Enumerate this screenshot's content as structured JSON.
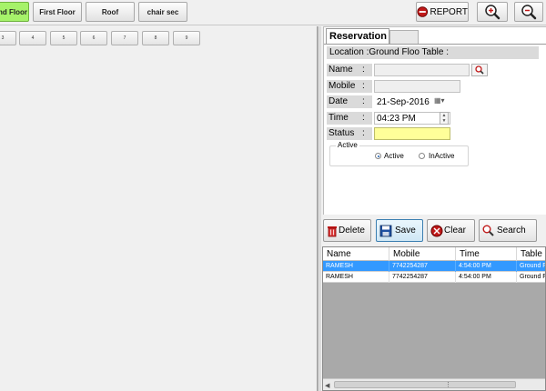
{
  "floors": [
    {
      "label": "nd Floor",
      "active": true
    },
    {
      "label": "First Floor",
      "active": false
    },
    {
      "label": "Roof",
      "active": false
    },
    {
      "label": "chair sec",
      "active": false
    }
  ],
  "toolbar": {
    "report_label": "REPORT",
    "zoom_in_icon": "zoom-in-icon",
    "zoom_out_icon": "zoom-out-icon"
  },
  "tables": [
    "3",
    "4",
    "5",
    "6",
    "7",
    "8",
    "9"
  ],
  "reservation": {
    "tab_label": "Reservation",
    "location": "Location :Ground Floo Table :",
    "fields": {
      "name_label": "Name",
      "name_value": "",
      "mobile_label": "Mobile",
      "mobile_value": "",
      "date_label": "Date",
      "date_value": "21-Sep-2016",
      "time_label": "Time",
      "time_value": "04:23 PM",
      "status_label": "Status",
      "status_value": "",
      "colon": ":"
    },
    "active_group": {
      "title": "Active",
      "options": [
        "Active",
        "InActive"
      ],
      "selected": "Active"
    }
  },
  "actions": {
    "delete_label": "Delete",
    "save_label": "Save",
    "clear_label": "Clear",
    "search_label": "Search"
  },
  "grid": {
    "columns": [
      "Name",
      "Mobile",
      "Time",
      "Table L"
    ],
    "rows": [
      {
        "name": "RAMESH",
        "mobile": "7742254287",
        "time": "4:54:00 PM",
        "table": "Ground F",
        "selected": true
      },
      {
        "name": "RAMESH",
        "mobile": "7742254287",
        "time": "4:54:00 PM",
        "table": "Ground F",
        "selected": false
      }
    ]
  },
  "colors": {
    "active_floor": "#a6f26a",
    "selection": "#3399ff",
    "status_field": "#ffff99"
  }
}
